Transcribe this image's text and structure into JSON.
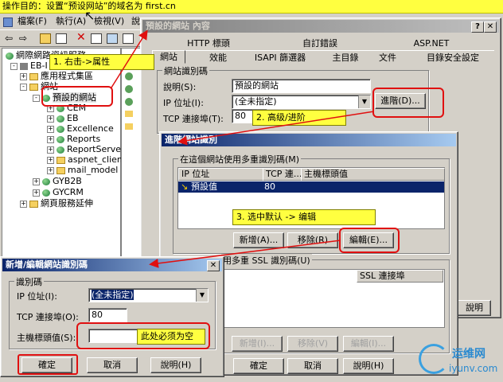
{
  "banner": {
    "label": "操作目的：",
    "text": "设置“预设网站”的域名为 first.cn"
  },
  "menubar": {
    "items": [
      "檔案(F)",
      "執行(A)",
      "檢視(V)",
      "說"
    ]
  },
  "tree": {
    "root_partial": "網際網路資訊服務",
    "server": "EB-I",
    "app_pools": "應用程式集區",
    "websites": "網站",
    "default_site": "預設的網站",
    "children": [
      "CEM",
      "EB",
      "Excellence",
      "Reports",
      "ReportServer",
      "aspnet_client",
      "mail_model",
      "GYB2B",
      "GYCRM"
    ],
    "service_ext": "網頁服務延伸"
  },
  "notes": {
    "step1": "1.  右击->属性",
    "step2": "2.  高级/进阶",
    "step3": "3. 选中默认 -> 编辑",
    "must_empty": "此处必须为空"
  },
  "props_window": {
    "title": "預設的網站 內容",
    "tabs_row1": [
      "HTTP 標頭",
      "自訂錯誤",
      "ASP.NET"
    ],
    "tabs_row2": [
      "網站",
      "效能",
      "ISAPI 篩選器",
      "主目錄",
      "文件",
      "目錄安全設定"
    ],
    "group_label": "網站識別碼",
    "desc_label": "說明(S):",
    "desc_value": "預設的網站",
    "ip_label": "IP 位址(I):",
    "ip_value": "(全未指定)",
    "advanced_button": "進階(D)...",
    "tcp_label": "TCP 連接埠(T):",
    "tcp_value": "80",
    "explain_button": "說明"
  },
  "adv_window": {
    "title_partial": "進階網站識別",
    "group_label": "在這個網站使用多重識別碼(M)",
    "columns": [
      "IP 位址",
      "TCP 連...",
      "主機標頭值"
    ],
    "rows": [
      {
        "ip": "預設值",
        "tcp": "80",
        "host": ""
      }
    ],
    "add_button": "新增(A)...",
    "remove_button": "移除(R)",
    "edit_button": "編輯(E)...",
    "ssl_group_label_partial": "用多重 SSL 識別碼(U)",
    "ssl_col": "SSL 連接埠",
    "ssl_add": "新增(I)...",
    "ssl_remove": "移除(V)",
    "ssl_edit": "編輯(I)...",
    "ok_button": "確定",
    "cancel_button": "取消",
    "help_button": "說明(H)"
  },
  "edit_window": {
    "title": "新增/編輯網站識別碼",
    "group_label": "識別碼",
    "ip_label": "IP 位址(I):",
    "ip_value": "(全未指定)",
    "tcp_label": "TCP 連接埠(O):",
    "tcp_value": "80",
    "host_label": "主機標頭值(S):",
    "host_value": "",
    "ok_button": "確定",
    "cancel_button": "取消",
    "help_button": "說明(H)"
  },
  "watermark": {
    "line1": "运维网",
    "line2": "iyunv.com"
  },
  "colors": {
    "note_bg": "#ffff40",
    "annotation_red": "#e01010",
    "title_active": "#0a246a",
    "selection": "#0a246a"
  }
}
